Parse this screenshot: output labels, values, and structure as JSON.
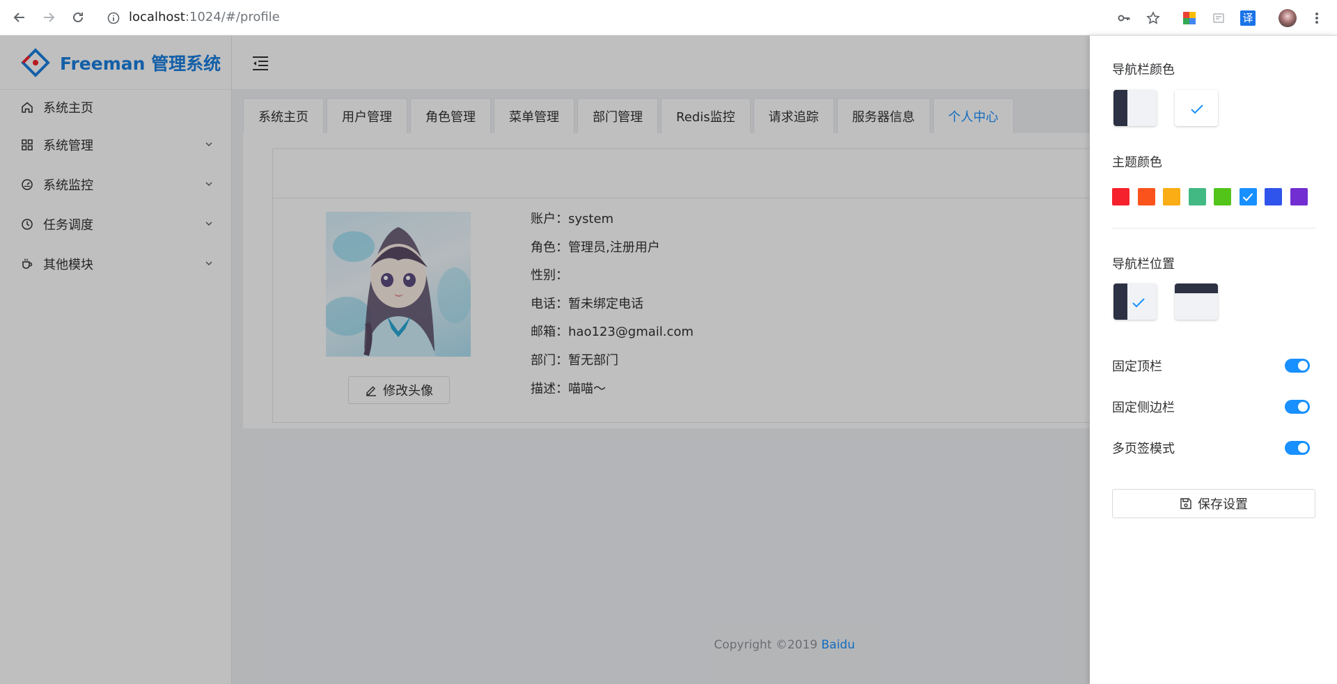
{
  "browser": {
    "url_host": "localhost",
    "url_path": ":1024/#/profile",
    "icons": [
      "back-icon",
      "forward-icon",
      "reload-icon",
      "info-icon",
      "key-icon",
      "star-icon",
      "extension-colorful-icon",
      "extension-box-icon",
      "translate-icon",
      "profile-avatar-icon",
      "more-menu-icon"
    ],
    "translate_label": "译"
  },
  "app": {
    "logo_text": "Freeman 管理系统",
    "brand_color": "#1a7fe0",
    "menu": [
      {
        "label": "系统主页",
        "icon": "home-icon",
        "expandable": false
      },
      {
        "label": "系统管理",
        "icon": "grid-icon",
        "expandable": true
      },
      {
        "label": "系统监控",
        "icon": "gauge-icon",
        "expandable": true
      },
      {
        "label": "任务调度",
        "icon": "clock-icon",
        "expandable": true
      },
      {
        "label": "其他模块",
        "icon": "coffee-icon",
        "expandable": true
      }
    ],
    "tabs": [
      {
        "label": "系统主页",
        "active": false
      },
      {
        "label": "用户管理",
        "active": false
      },
      {
        "label": "角色管理",
        "active": false
      },
      {
        "label": "菜单管理",
        "active": false
      },
      {
        "label": "部门管理",
        "active": false
      },
      {
        "label": "Redis监控",
        "active": false
      },
      {
        "label": "请求追踪",
        "active": false
      },
      {
        "label": "服务器信息",
        "active": false
      },
      {
        "label": "个人中心",
        "active": true
      }
    ],
    "profile": {
      "edit_avatar_label": "修改头像",
      "fields": [
        {
          "label": "账户：",
          "value": "system"
        },
        {
          "label": "角色：",
          "value": "管理员,注册用户"
        },
        {
          "label": "性别：",
          "value": ""
        },
        {
          "label": "电话：",
          "value": "暂未绑定电话"
        },
        {
          "label": "邮箱：",
          "value": "hao123@gmail.com"
        },
        {
          "label": "部门：",
          "value": "暂无部门"
        },
        {
          "label": "描述：",
          "value": "喵喵～"
        }
      ]
    },
    "footer": {
      "copyright": "Copyright ©2019 ",
      "link": "Baidu"
    }
  },
  "settings": {
    "nav_color_title": "导航栏颜色",
    "theme_color_title": "主题颜色",
    "theme_colors": [
      "#f5222d",
      "#fa541c",
      "#faad14",
      "#42b983",
      "#52c41a",
      "#1890ff",
      "#2f54eb",
      "#722ed1"
    ],
    "selected_theme_color": "#1890ff",
    "nav_position_title": "导航栏位置",
    "switches": [
      {
        "label": "固定顶栏",
        "on": true
      },
      {
        "label": "固定侧边栏",
        "on": true
      },
      {
        "label": "多页签模式",
        "on": true
      }
    ],
    "save_label": "保存设置"
  }
}
